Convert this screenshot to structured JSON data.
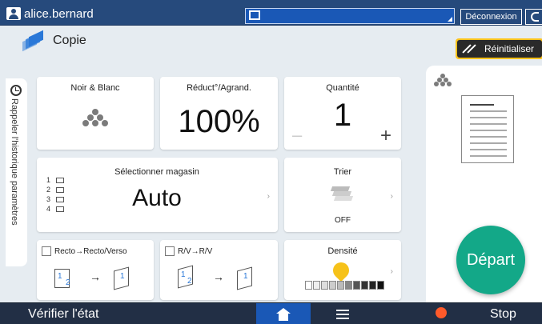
{
  "topbar": {
    "user": "alice.bernard",
    "logout_label": "Déconnexion"
  },
  "app": {
    "title": "Copie",
    "reset_label": "Réinitialiser",
    "history_label": "Rappeler l'historique paramètres"
  },
  "cards": {
    "color": {
      "label": "Noir & Blanc"
    },
    "zoom": {
      "label": "Réduct°/Agrand.",
      "value": "100%"
    },
    "quantity": {
      "label": "Quantité",
      "value": "1",
      "minus": "–",
      "plus": "+"
    },
    "tray": {
      "label": "Sélectionner magasin",
      "value": "Auto",
      "rows": [
        "1",
        "2",
        "3",
        "4"
      ]
    },
    "sort": {
      "label": "Trier",
      "value": "OFF"
    },
    "duplex": {
      "label": "Recto→Recto/Verso",
      "page1": "1",
      "page2": "2",
      "page_out": "1"
    },
    "rv": {
      "label": "R/V→R/V",
      "page1": "1",
      "page2": "2",
      "page_out": "1"
    },
    "density": {
      "label": "Densité"
    }
  },
  "start_label": "Départ",
  "bottombar": {
    "check_label": "Vérifier l'état",
    "stop_label": "Stop"
  },
  "colors": {
    "accent_blue": "#1a58b6",
    "start_green": "#13a888",
    "reset_yellow": "#ffc21a",
    "stop_red": "#ff5a2a"
  }
}
